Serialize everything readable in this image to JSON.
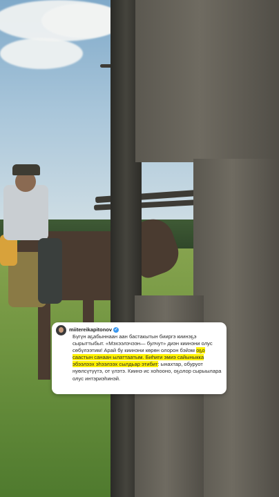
{
  "caption": {
    "username": "miitereikapitonov",
    "verified": true,
    "segments": [
      {
        "text": "Бүгүн аҕабыннаан аан бастакытын биир­гэ киинэҕэ сырыттыбыт. «Мэхээлэчээн— булчут» диэн киинэни олус сөбүлээтим! Арай бу киинэни көрөн олорон бэйэм ",
        "highlight": false
      },
      {
        "text": "оҕо саастын санаан ылаттаатым. Биһиги эмиэ сайыныкка эбээлээх эһээлээх сылдьар этибит",
        "highlight": true
      },
      {
        "text": ": ынахтар, обуруот нуөлсүтүүтэ, от үлэтэ. Киинэ ис хоһооно, оҕолор сырыылара олус интэриэһинэй.",
        "highlight": false
      }
    ]
  },
  "colors": {
    "highlight": "#fff200",
    "verified_badge": "#3897f0"
  },
  "icons": {
    "verified": "verified-badge-icon",
    "avatar": "profile-avatar"
  }
}
